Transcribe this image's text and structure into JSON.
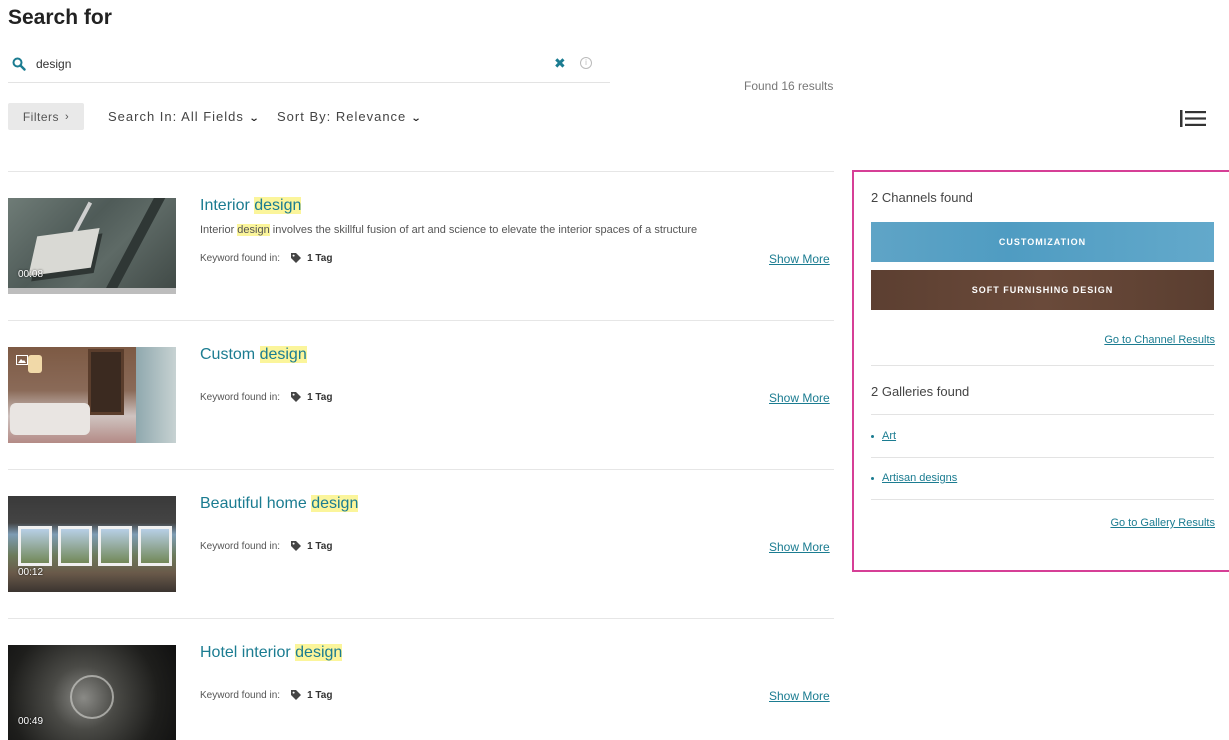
{
  "page": {
    "title": "Search for"
  },
  "search": {
    "value": "design",
    "placeholder": ""
  },
  "results_summary": {
    "found_text": "Found 16 results"
  },
  "toolbar": {
    "filters_label": "Filters",
    "search_in_label": "Search In: All Fields",
    "sort_by_label": "Sort By: Relevance"
  },
  "results": [
    {
      "title_prefix": "Interior ",
      "title_highlight": "design",
      "title_suffix": "",
      "desc_prefix": "Interior ",
      "desc_highlight": "design",
      "desc_suffix": " involves the skillful fusion of art and science to elevate the interior spaces of a structure",
      "duration": "00:08",
      "keyword_label": "Keyword found in:",
      "tag_count": "1 Tag",
      "show_more": "Show More"
    },
    {
      "title_prefix": "Custom ",
      "title_highlight": "design",
      "title_suffix": "",
      "duration": "",
      "keyword_label": "Keyword found in:",
      "tag_count": "1 Tag",
      "show_more": "Show More"
    },
    {
      "title_prefix": "Beautiful home ",
      "title_highlight": "design",
      "title_suffix": "",
      "duration": "00:12",
      "keyword_label": "Keyword found in:",
      "tag_count": "1 Tag",
      "show_more": "Show More"
    },
    {
      "title_prefix": "Hotel interior ",
      "title_highlight": "design",
      "title_suffix": "",
      "duration": "00:49",
      "keyword_label": "Keyword found in:",
      "tag_count": "1 Tag",
      "show_more": "Show More"
    }
  ],
  "side_panel": {
    "channels_heading": "2 Channels found",
    "channels": [
      {
        "label": "CUSTOMIZATION"
      },
      {
        "label": "SOFT FURNISHING DESIGN"
      }
    ],
    "channels_link": "Go to Channel Results",
    "galleries_heading": "2 Galleries found",
    "galleries": [
      {
        "label": "Art"
      },
      {
        "label": "Artisan designs"
      }
    ],
    "galleries_link": "Go to Gallery Results"
  },
  "colors": {
    "accent": "#1b7c91",
    "highlight": "#fbf59b",
    "panel_border": "#d63f96"
  }
}
